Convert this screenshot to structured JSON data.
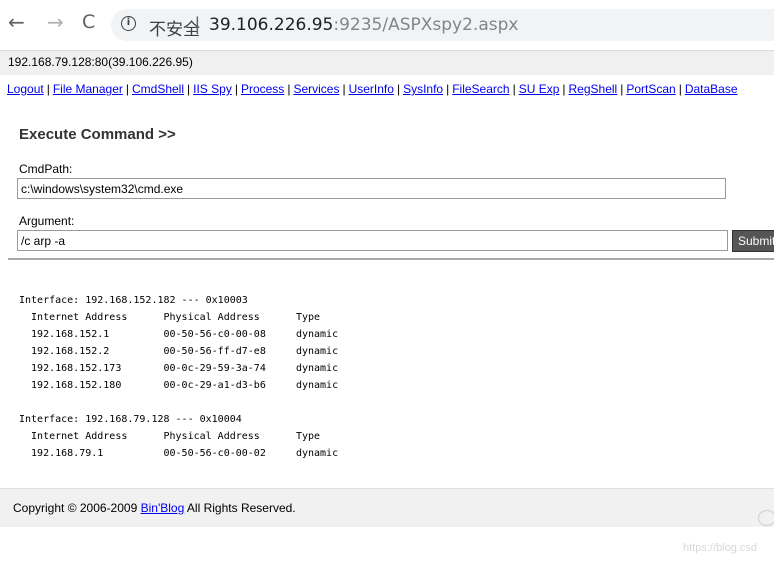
{
  "browser": {
    "back_icon": "←",
    "forward_icon": "→",
    "reload_icon": "C",
    "security_label": "不安全",
    "url_host": "39.106.226.95",
    "url_rest": ":9235/ASPXspy2.aspx"
  },
  "host_info": "192.168.79.128:80(39.106.226.95)",
  "menu": [
    "Logout",
    "File Manager",
    "CmdShell",
    "IIS Spy",
    "Process",
    "Services",
    "UserInfo",
    "SysInfo",
    "FileSearch",
    "SU Exp",
    "RegShell",
    "PortScan",
    "DataBase"
  ],
  "execute": {
    "title": "Execute Command >>",
    "cmdpath_label": "CmdPath:",
    "cmdpath_value": "c:\\windows\\system32\\cmd.exe",
    "argument_label": "Argument:",
    "argument_value": "/c arp -a",
    "submit_label": "Submit"
  },
  "output": "Interface: 192.168.152.182 --- 0x10003\n  Internet Address      Physical Address      Type\n  192.168.152.1         00-50-56-c0-00-08     dynamic\n  192.168.152.2         00-50-56-ff-d7-e8     dynamic\n  192.168.152.173       00-0c-29-59-3a-74     dynamic\n  192.168.152.180       00-0c-29-a1-d3-b6     dynamic\n\nInterface: 192.168.79.128 --- 0x10004\n  Internet Address      Physical Address      Type\n  192.168.79.1          00-50-56-c0-00-02     dynamic",
  "footer": {
    "prefix": "Copyright © 2006-2009 ",
    "link": "Bin'Blog",
    "suffix": " All Rights Reserved."
  },
  "watermark": "https://blog.csd"
}
